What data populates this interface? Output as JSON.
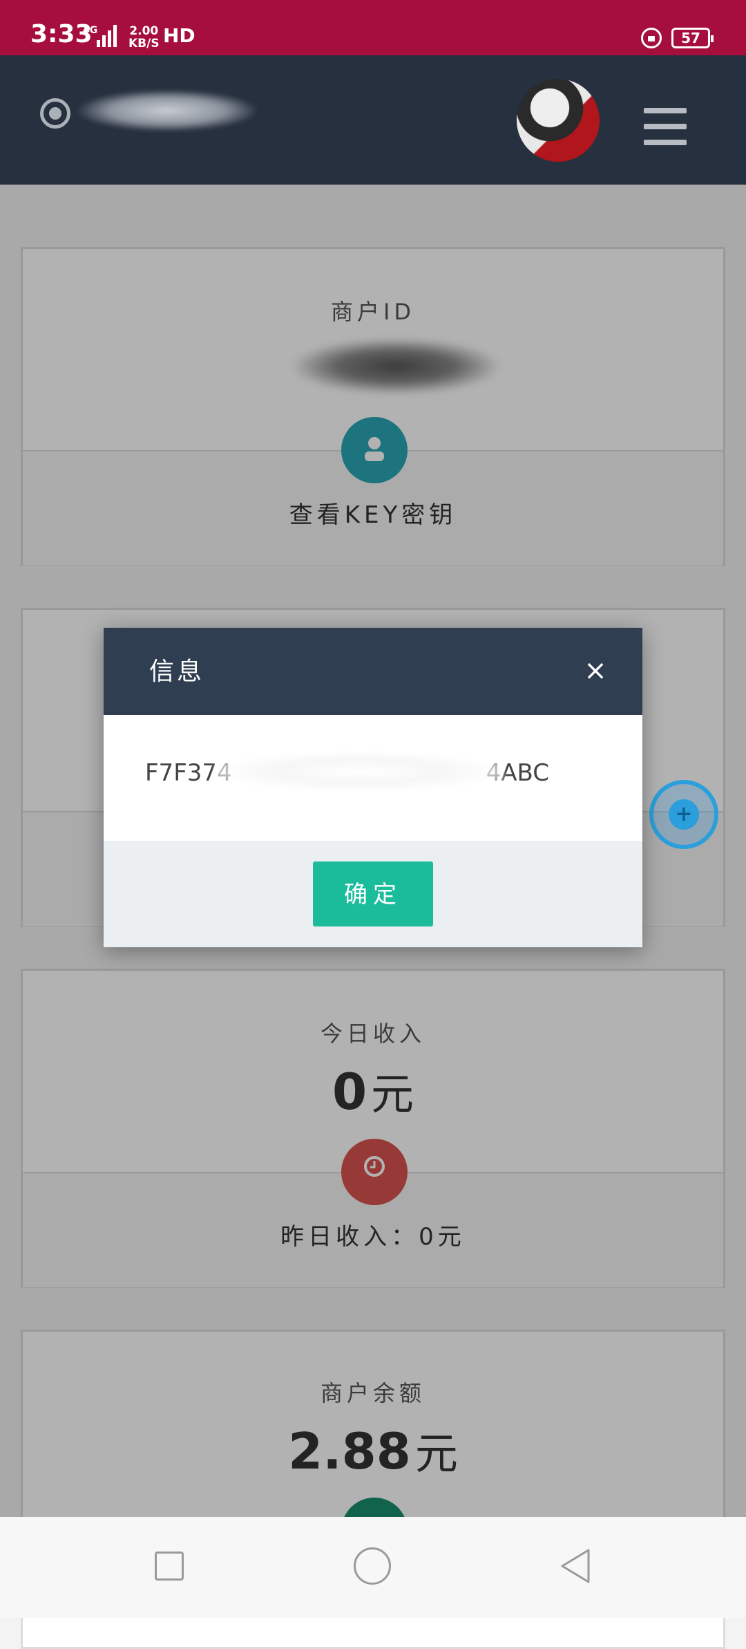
{
  "status_bar": {
    "time": "3:33",
    "network": "4G",
    "speed_value": "2.00",
    "speed_unit": "KB/S",
    "hd": "HD",
    "battery": "57"
  },
  "header": {
    "logo_icon": "target-ring-icon",
    "menu_icon": "hamburger-menu-icon"
  },
  "cards": {
    "merchant": {
      "title": "商户ID",
      "footer": "查看KEY密钥",
      "icon": "user-icon",
      "icon_color": "#2aa7b6"
    },
    "income": {
      "title": "今日收入",
      "value": "0",
      "unit": "元",
      "footer": "昨日收入：0元",
      "icon": "clock-icon",
      "icon_color": "#d9534f"
    },
    "balance": {
      "title": "商户余额",
      "value": "2.88",
      "unit": "元",
      "icon_color": "#1a8f6e"
    }
  },
  "dialog": {
    "title": "信息",
    "key_start": "F7F374",
    "key_end": "4ABC",
    "ok_label": "确定",
    "header_color": "#2f3e51",
    "ok_color": "#1abc9c"
  },
  "colors": {
    "status_bar": "#a60e3d",
    "app_header": "#27303f"
  }
}
